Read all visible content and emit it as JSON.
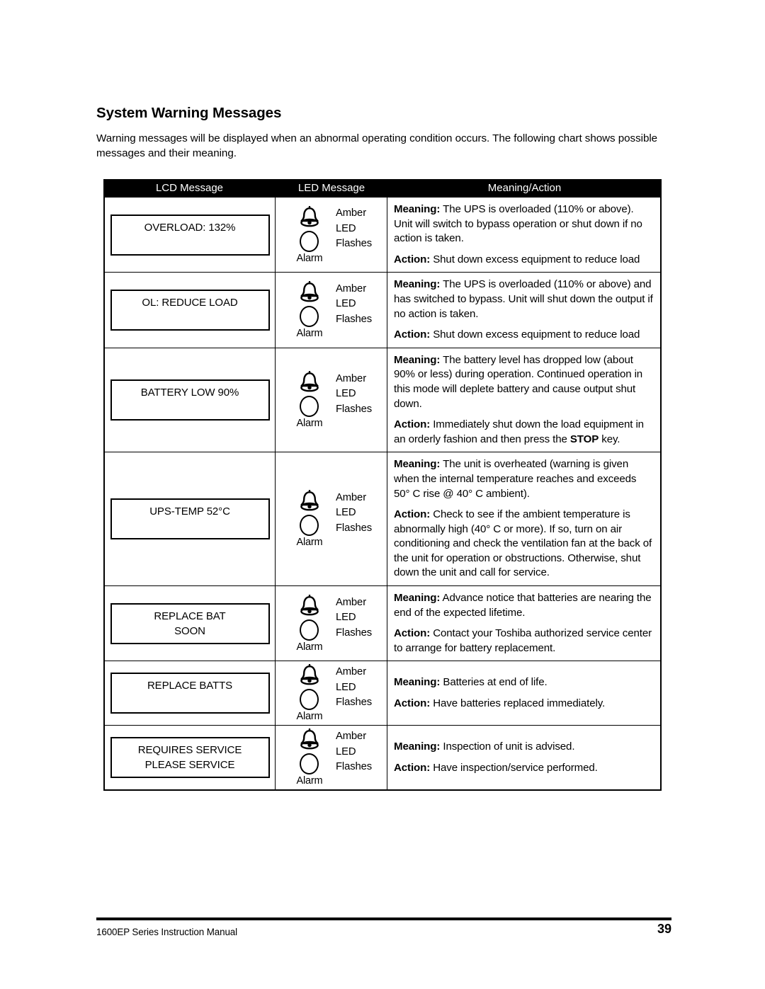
{
  "document": {
    "section_title": "System Warning Messages",
    "intro": "Warning messages will be displayed when an abnormal operating condition occurs. The following chart shows possible messages and their meaning."
  },
  "table": {
    "headers": {
      "lcd": "LCD Message",
      "led": "LED Message",
      "meaning": "Meaning/Action"
    },
    "led_common": {
      "alarm_label": "Alarm",
      "line1": "Amber",
      "line2": "LED",
      "line3": "Flashes",
      "bell_icon": "bell-icon",
      "led_icon": "led-circle-icon"
    },
    "rows": [
      {
        "lcd_line1": "OVERLOAD: 132%",
        "lcd_line2": "",
        "meaning_label": "Meaning:",
        "meaning_text": " The UPS is overloaded (110% or above). Unit will switch to bypass operation or shut down if no action is taken.",
        "action_label": "Action:",
        "action_text": " Shut down excess equipment to reduce load"
      },
      {
        "lcd_line1": "OL: REDUCE LOAD",
        "lcd_line2": "",
        "meaning_label": "Meaning:",
        "meaning_text": " The UPS is overloaded (110% or above) and has switched to bypass. Unit will shut down the output if no action is taken.",
        "action_label": "Action:",
        "action_text": " Shut down excess equipment to reduce load"
      },
      {
        "lcd_line1": "BATTERY LOW 90%",
        "lcd_line2": "",
        "meaning_label": "Meaning:",
        "meaning_text": " The battery level has dropped low (about 90% or less) during operation. Continued operation in this mode will deplete battery and cause output shut down.",
        "action_label": "Action:",
        "action_text": " Immediately shut down the load equipment in an orderly fashion and then press the ",
        "action_bold": "STOP",
        "action_tail": " key."
      },
      {
        "lcd_line1": "UPS-TEMP 52°C",
        "lcd_line2": "",
        "meaning_label": "Meaning:",
        "meaning_text": " The unit is overheated (warning is given when the internal temperature reaches and exceeds 50° C rise @ 40° C ambient).",
        "action_label": "Action:",
        "action_text": " Check to see if the ambient temperature is abnormally high (40° C or more). If so, turn on air conditioning and check the ventilation fan at the back of the unit for operation or obstructions. Otherwise, shut down the unit and call for service."
      },
      {
        "lcd_line1": "REPLACE BAT",
        "lcd_line2": "SOON",
        "meaning_label": "Meaning:",
        "meaning_text": " Advance notice that batteries are nearing the end of the expected lifetime.",
        "action_label": "Action:",
        "action_text": " Contact your Toshiba authorized service center to arrange for battery replacement."
      },
      {
        "lcd_line1": "REPLACE BATTS",
        "lcd_line2": "",
        "meaning_label": "Meaning:",
        "meaning_text": " Batteries at end of life.",
        "action_label": "Action:",
        "action_text": " Have batteries replaced immediately."
      },
      {
        "lcd_line1": "REQUIRES SERVICE",
        "lcd_line2": "PLEASE SERVICE",
        "meaning_label": "Meaning:",
        "meaning_text": " Inspection of unit is advised.",
        "action_label": "Action:",
        "action_text": " Have inspection/service performed."
      }
    ]
  },
  "footer": {
    "manual": "1600EP Series Instruction Manual",
    "page_number": "39"
  }
}
